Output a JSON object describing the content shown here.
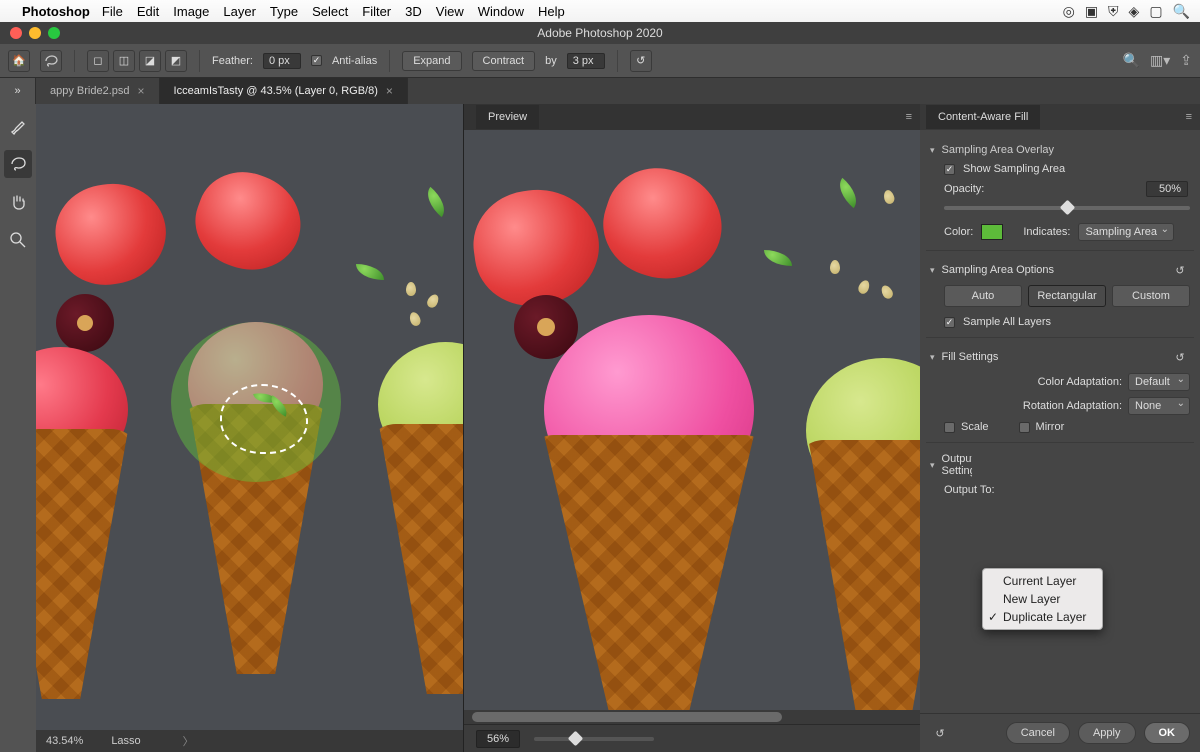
{
  "mac_menu": {
    "app": "Photoshop",
    "items": [
      "File",
      "Edit",
      "Image",
      "Layer",
      "Type",
      "Select",
      "Filter",
      "3D",
      "View",
      "Window",
      "Help"
    ]
  },
  "window": {
    "title": "Adobe Photoshop 2020"
  },
  "options_bar": {
    "feather_label": "Feather:",
    "feather_value": "0 px",
    "antialias_label": "Anti-alias",
    "expand_btn": "Expand",
    "contract_btn": "Contract",
    "by_label": "by",
    "by_value": "3 px"
  },
  "tabs": {
    "inactive": "appy Bride2.psd",
    "active": "IcceamIsTasty @ 43.5% (Layer 0, RGB/8)"
  },
  "preview_label": "Preview",
  "left_status": {
    "zoom": "43.54%",
    "tool": "Lasso"
  },
  "preview_bar": {
    "zoom": "56%"
  },
  "caf": {
    "panel_title": "Content-Aware Fill",
    "overlay_section": "Sampling Area Overlay",
    "show_sampling_label": "Show Sampling Area",
    "opacity_label": "Opacity:",
    "opacity_value": "50%",
    "color_label": "Color:",
    "indicates_label": "Indicates:",
    "indicates_value": "Sampling Area",
    "options_section": "Sampling Area Options",
    "mode_auto": "Auto",
    "mode_rect": "Rectangular",
    "mode_custom": "Custom",
    "sample_all_label": "Sample All Layers",
    "fill_section": "Fill Settings",
    "color_adapt_label": "Color Adaptation:",
    "color_adapt_value": "Default",
    "rot_adapt_label": "Rotation Adaptation:",
    "rot_adapt_value": "None",
    "scale_label": "Scale",
    "mirror_label": "Mirror",
    "output_section": "Output Settings",
    "output_to_label": "Output To:",
    "popup_items": [
      "Current Layer",
      "New Layer",
      "Duplicate Layer"
    ],
    "popup_selected_index": 2
  },
  "buttons": {
    "cancel": "Cancel",
    "apply": "Apply",
    "ok": "OK"
  }
}
